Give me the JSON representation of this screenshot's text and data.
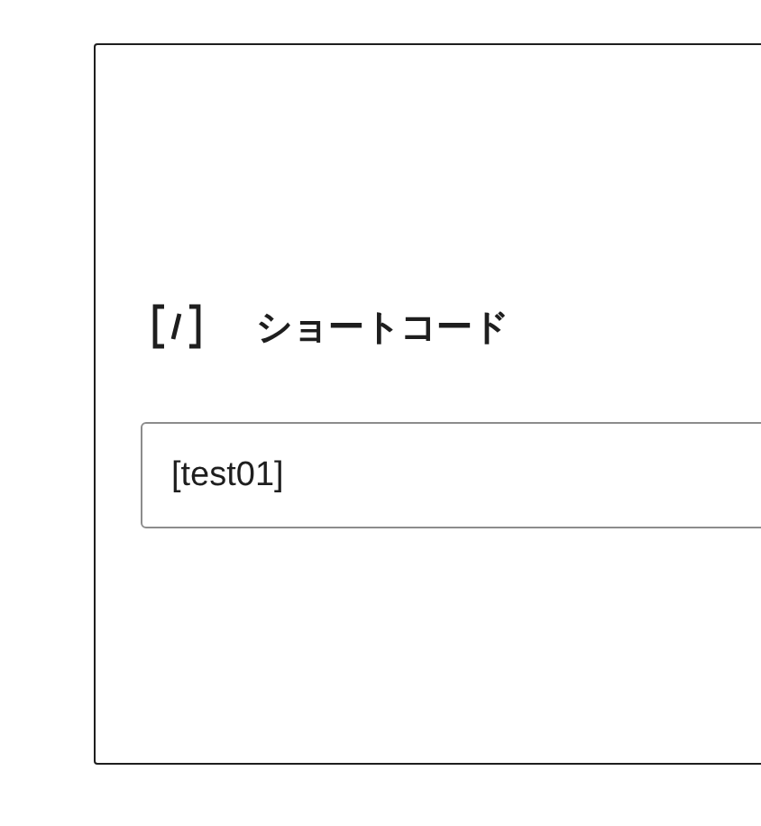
{
  "shortcode_block": {
    "label": "ショートコード",
    "input": {
      "value": "[test01]"
    }
  }
}
